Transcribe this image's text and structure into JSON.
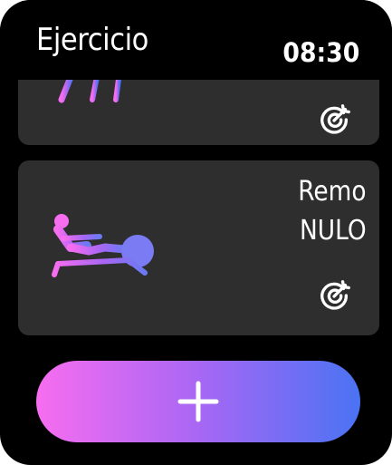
{
  "header": {
    "title": "Ejercicio",
    "time": "08:30"
  },
  "cards": [
    {
      "id": "partial-card",
      "icon": "exercise-equipment-icon",
      "goal_icon": "target-icon"
    },
    {
      "id": "remo",
      "name": "Remo",
      "status": "NULO",
      "icon": "rowing-machine-icon",
      "goal_icon": "target-icon"
    }
  ],
  "add_button": {
    "icon": "plus-icon"
  },
  "colors": {
    "background": "#000000",
    "card": "#2e2e2e",
    "text": "#ffffff",
    "gradient_start": "#f76df0",
    "gradient_mid": "#a867f4",
    "gradient_end": "#4a73f3"
  }
}
